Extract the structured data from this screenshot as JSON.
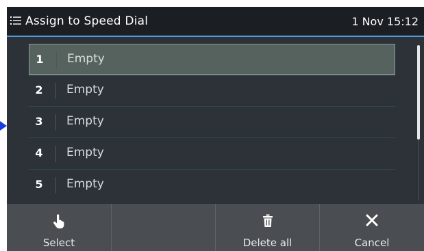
{
  "header": {
    "title": "Assign to Speed Dial",
    "clock": "1 Nov 15:12"
  },
  "list": [
    {
      "num": "1",
      "label": "Empty",
      "selected": true
    },
    {
      "num": "2",
      "label": "Empty"
    },
    {
      "num": "3",
      "label": "Empty"
    },
    {
      "num": "4",
      "label": "Empty"
    },
    {
      "num": "5",
      "label": "Empty"
    }
  ],
  "softkeys": {
    "select": {
      "label": "Select",
      "icon": "hand-pointer-icon"
    },
    "blank": {
      "label": ""
    },
    "delete_all": {
      "label": "Delete all",
      "icon": "trash-icon"
    },
    "cancel": {
      "label": "Cancel",
      "icon": "close-icon"
    }
  },
  "colors": {
    "accent": "#4f97d6",
    "header_bg": "#1b1f23",
    "screen_bg": "#2c3238",
    "softkey_bg": "#4a4e52",
    "marker": "#1a3de0"
  }
}
